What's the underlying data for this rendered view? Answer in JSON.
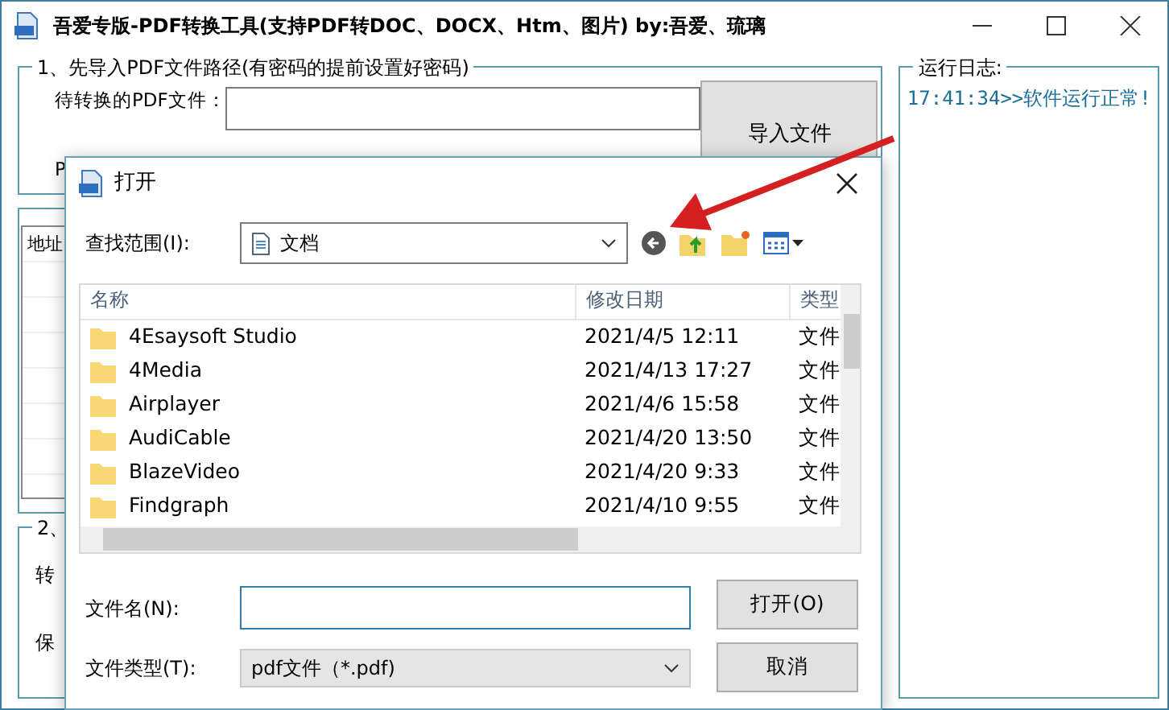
{
  "window": {
    "title": "吾爱专版-PDF转换工具(支持PDF转DOC、DOCX、Htm、图片)  by:吾爱、琉璃"
  },
  "import_group": {
    "title": "1、先导入PDF文件路径(有密码的提前设置好密码)",
    "file_label": "待转换的PDF文件：",
    "import_button": "导入文件",
    "second_label": "P"
  },
  "table_group": {
    "column_1": "地址"
  },
  "convert_group": {
    "title": "2、",
    "first_label": "转",
    "second_label": "保"
  },
  "log": {
    "title": "运行日志:",
    "entries": [
      "17:41:34>>软件运行正常!"
    ]
  },
  "dialog": {
    "title": "打开",
    "look_in_label": "查找范围(I):",
    "look_in_value": "文档",
    "columns": [
      "名称",
      "修改日期",
      "类型"
    ],
    "rows": [
      {
        "name": "4Esaysoft Studio",
        "modified": "2021/4/5 12:11",
        "type": "文件"
      },
      {
        "name": "4Media",
        "modified": "2021/4/13 17:27",
        "type": "文件"
      },
      {
        "name": "Airplayer",
        "modified": "2021/4/6 15:58",
        "type": "文件"
      },
      {
        "name": "AudiCable",
        "modified": "2021/4/20 13:50",
        "type": "文件"
      },
      {
        "name": "BlazeVideo",
        "modified": "2021/4/20 9:33",
        "type": "文件"
      },
      {
        "name": "Findgraph",
        "modified": "2021/4/10 9:55",
        "type": "文件"
      }
    ],
    "file_name_label": "文件名(N):",
    "file_type_label": "文件类型(T):",
    "file_type_value": "pdf文件（*.pdf)",
    "open_button": "打开(O)",
    "cancel_button": "取消"
  }
}
